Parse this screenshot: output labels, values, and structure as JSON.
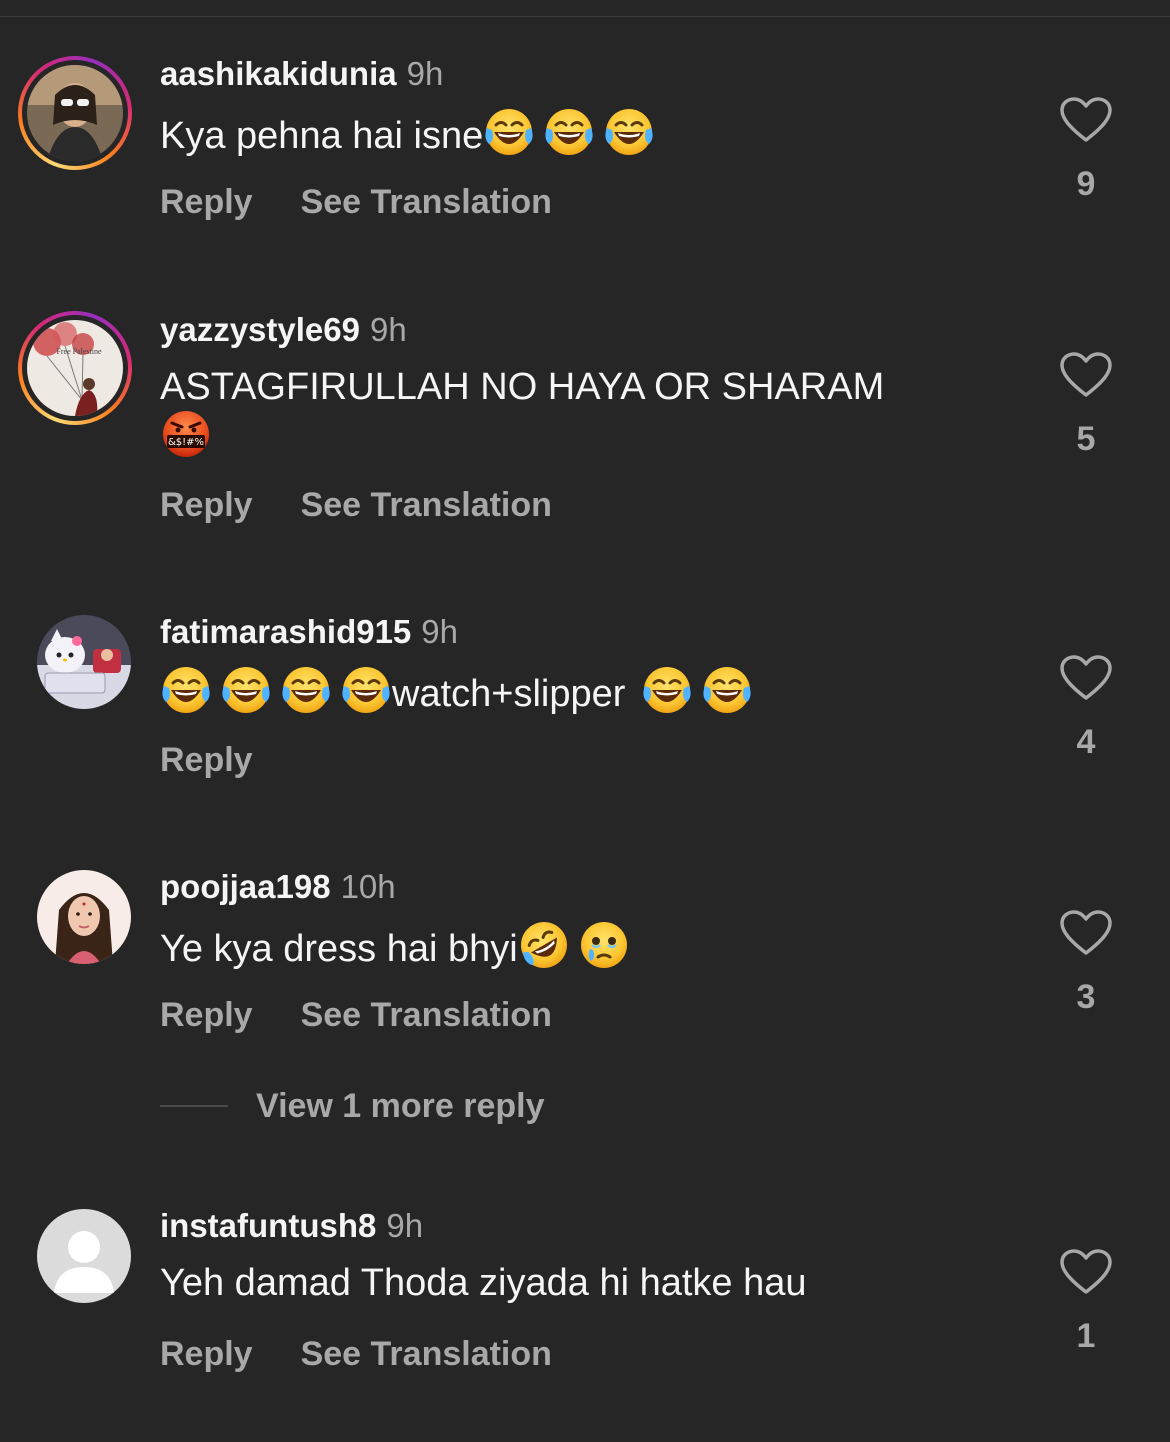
{
  "comments": [
    {
      "username": "aashikakidunia",
      "time": "9h",
      "text": "Kya pehna hai isne",
      "emojis": [
        "laughing-tears-emoji",
        "laughing-tears-emoji",
        "laughing-tears-emoji"
      ],
      "reply_label": "Reply",
      "translation_label": "See Translation",
      "likes": "9"
    },
    {
      "username": "yazzystyle69",
      "time": "9h",
      "text": "ASTAGFIRULLAH NO HAYA OR SHARAM",
      "emojis": [
        "cursing-face-emoji"
      ],
      "reply_label": "Reply",
      "translation_label": "See Translation",
      "likes": "5"
    },
    {
      "username": "fatimarashid915",
      "time": "9h",
      "text": "watch+slipper",
      "emojis_before": [
        "laughing-tears-emoji",
        "laughing-tears-emoji",
        "laughing-tears-emoji",
        "laughing-tears-emoji"
      ],
      "emojis": [
        "laughing-tears-emoji",
        "laughing-tears-emoji"
      ],
      "reply_label": "Reply",
      "likes": "4"
    },
    {
      "username": "poojjaa198",
      "time": "10h",
      "text": "Ye kya dress hai bhyi",
      "emojis": [
        "rolling-laughing-emoji",
        "holding-back-tears-emoji"
      ],
      "reply_label": "Reply",
      "translation_label": "See Translation",
      "likes": "3",
      "view_more_label": "View 1 more reply"
    },
    {
      "username": "instafuntush8",
      "time": "9h",
      "text": "Yeh damad Thoda ziyada hi hatke hau",
      "reply_label": "Reply",
      "translation_label": "See Translation",
      "likes": "1"
    }
  ],
  "avatar_overlay_text": "Free Palestine",
  "emoji_symbols": {
    "cursing": "&$!#%"
  },
  "colors": {
    "background": "#262626",
    "primary_text": "#f5f5f5",
    "secondary_text": "#a8a8a8",
    "story_ring": [
      "#feda75",
      "#fa7e1e",
      "#d62976",
      "#962fbf"
    ]
  }
}
